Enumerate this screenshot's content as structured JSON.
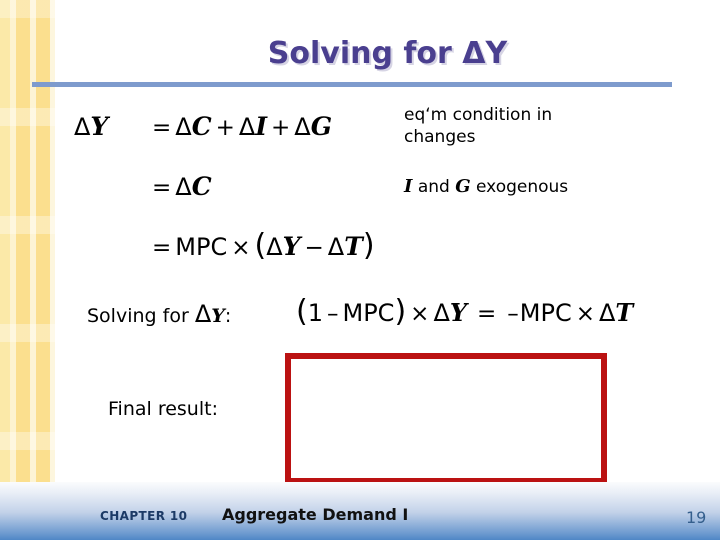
{
  "slide": {
    "title": "Solving for ΔY",
    "equations": [
      {
        "lhs": "ΔY",
        "relation": "=",
        "rhs": "ΔC + ΔI + ΔG",
        "parts": {
          "d1": "Δ",
          "v1": "Y",
          "eq": "=",
          "d2": "Δ",
          "v2": "C",
          "plus1": "+",
          "d3": "Δ",
          "v3": "I",
          "plus2": "+",
          "d4": "Δ",
          "v4": "G"
        }
      },
      {
        "lhs": "",
        "relation": "=",
        "rhs": "ΔC",
        "parts": {
          "eq": "=",
          "d1": "Δ",
          "v1": "C"
        }
      },
      {
        "lhs": "",
        "relation": "=",
        "rhs": "MPC × (ΔY − ΔT)",
        "parts": {
          "eq": "=",
          "mpc": "MPC",
          "times": "×",
          "open": "(",
          "d1": "Δ",
          "v1": "Y",
          "minus": "−",
          "d2": "Δ",
          "v2": "T",
          "close": ")"
        }
      }
    ],
    "notes": {
      "eqm_line1": "eq‘m condition in",
      "eqm_line2": "changes",
      "exogenous": {
        "var1": "I",
        "conjunction": "and",
        "var2": "G",
        "tail": "exogenous"
      }
    },
    "solving": {
      "label": "Solving for ΔY :",
      "label_text": "Solving for",
      "label_delta": "Δ",
      "label_var": "Y",
      "label_colon": ":",
      "equation": "(1 − MPC) × ΔY = −MPC × ΔT",
      "parts": {
        "open": "(",
        "one": "1",
        "minus1": "–",
        "mpc1": "MPC",
        "close": ")",
        "times1": "×",
        "d1": "Δ",
        "v1": "Y",
        "eq": "=",
        "minus2": "–",
        "mpc2": "MPC",
        "times2": "×",
        "d2": "Δ",
        "v2": "T"
      }
    },
    "final_result": {
      "label": "Final result:",
      "box_content": ""
    },
    "footer": {
      "chapter": "CHAPTER 10",
      "subject": "Aggregate Demand I",
      "slide_number": "19"
    },
    "colors": {
      "title": "#4a3f8f",
      "rule": "#7e9bcd",
      "sidebar": "#fdeeb8",
      "final_box_border": "#bb1212",
      "footer_gradient_bottom": "#4f86c6",
      "slide_number": "#355f8d"
    }
  }
}
